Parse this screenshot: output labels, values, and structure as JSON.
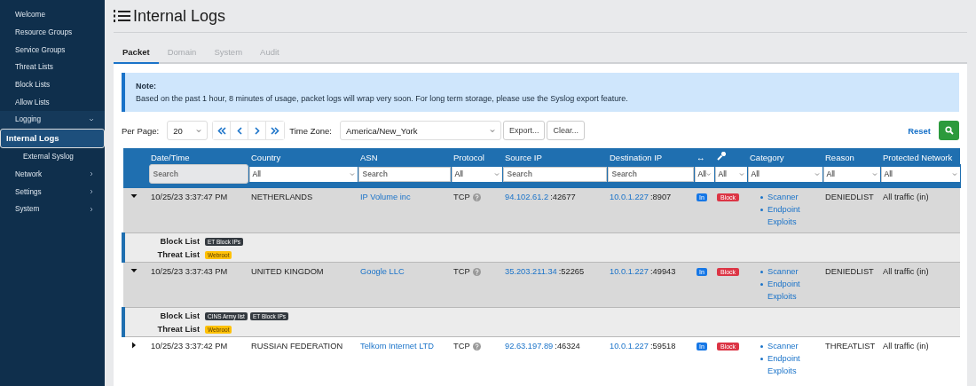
{
  "sidebar": {
    "items": [
      {
        "label": "Welcome",
        "kind": "link",
        "selected": false
      },
      {
        "label": "Resource Groups",
        "kind": "link",
        "selected": false
      },
      {
        "label": "Service Groups",
        "kind": "link",
        "selected": false
      },
      {
        "label": "Threat Lists",
        "kind": "link",
        "selected": false
      },
      {
        "label": "Block Lists",
        "kind": "link",
        "selected": false
      },
      {
        "label": "Allow Lists",
        "kind": "link",
        "selected": false
      },
      {
        "label": "Logging",
        "kind": "group",
        "selected": false,
        "expanded": true,
        "children": [
          {
            "label": "Internal Logs",
            "selected": true
          },
          {
            "label": "External Syslog",
            "selected": false
          }
        ]
      },
      {
        "label": "Network",
        "kind": "group",
        "selected": false,
        "expanded": false
      },
      {
        "label": "Settings",
        "kind": "group",
        "selected": false,
        "expanded": false
      },
      {
        "label": "System",
        "kind": "group",
        "selected": false,
        "expanded": false
      }
    ]
  },
  "page": {
    "title": "Internal Logs"
  },
  "tabs": [
    {
      "label": "Packet",
      "selected": true
    },
    {
      "label": "Domain",
      "selected": false
    },
    {
      "label": "System",
      "selected": false
    },
    {
      "label": "Audit",
      "selected": false
    }
  ],
  "note": {
    "title": "Note:",
    "text": "Based on the past 1 hour, 8 minutes of usage, packet logs will wrap very soon. For long term storage, please use the Syslog export feature."
  },
  "toolbar": {
    "per_page_label": "Per Page:",
    "per_page": "20",
    "time_zone_label": "Time Zone:",
    "time_zone": "America/New_York",
    "buttons": [
      "Export...",
      "Clear..."
    ],
    "reset": "Reset"
  },
  "table": {
    "columns": [
      {
        "kind": "expander"
      },
      {
        "kind": "text",
        "label": "Date/Time",
        "filter": {
          "kind": "search",
          "placeholder": "Search",
          "disabled": true
        }
      },
      {
        "kind": "text",
        "label": "Country",
        "filter": {
          "kind": "select",
          "value": "All"
        }
      },
      {
        "kind": "text",
        "label": "ASN",
        "filter": {
          "kind": "search",
          "placeholder": "Search",
          "disabled": false
        }
      },
      {
        "kind": "text",
        "label": "Protocol",
        "filter": {
          "kind": "select",
          "value": "All"
        }
      },
      {
        "kind": "text",
        "label": "Source IP",
        "filter": {
          "kind": "search",
          "placeholder": "Search",
          "disabled": false
        }
      },
      {
        "kind": "text",
        "label": "Destination IP",
        "filter": {
          "kind": "search",
          "placeholder": "Search",
          "disabled": false
        }
      },
      {
        "kind": "text",
        "label": "↔",
        "filter": {
          "kind": "select",
          "value": "All"
        }
      },
      {
        "kind": "icon",
        "filter": {
          "kind": "select",
          "value": "All"
        }
      },
      {
        "kind": "text",
        "label": "Category",
        "filter": {
          "kind": "select",
          "value": "All"
        }
      },
      {
        "kind": "text",
        "label": "Reason",
        "filter": {
          "kind": "select",
          "value": "All"
        }
      },
      {
        "kind": "text",
        "label": "Protected Network",
        "filter": {
          "kind": "select",
          "value": "All"
        }
      }
    ],
    "rows": [
      {
        "expanded": true,
        "date": "10/25/23 3:37:47 PM",
        "country": "NETHERLANDS",
        "asn": "IP Volume inc",
        "protocol": "TCP",
        "source_ip": "94.102.61.2",
        "source_port": ":42677",
        "dest_ip": "10.0.1.227",
        "dest_port": ":8907",
        "direction": "In",
        "action": "Block",
        "categories": [
          "Scanner",
          "Endpoint Exploits"
        ],
        "reason": "DENIEDLIST",
        "network": "All traffic (in)",
        "details": [
          {
            "label": "Block List",
            "tags": [
              {
                "label": "ET Block IPs",
                "color": "#343a40"
              }
            ]
          },
          {
            "label": "Threat List",
            "tags": [
              {
                "label": "Webroot",
                "color": "#ffc107"
              }
            ]
          }
        ]
      },
      {
        "expanded": true,
        "date": "10/25/23 3:37:43 PM",
        "country": "UNITED KINGDOM",
        "asn": "Google LLC",
        "protocol": "TCP",
        "source_ip": "35.203.211.34",
        "source_port": ":52265",
        "dest_ip": "10.0.1.227",
        "dest_port": ":49943",
        "direction": "In",
        "action": "Block",
        "categories": [
          "Scanner",
          "Endpoint Exploits"
        ],
        "reason": "DENIEDLIST",
        "network": "All traffic (in)",
        "details": [
          {
            "label": "Block List",
            "tags": [
              {
                "label": "CINS Army list",
                "color": "#343a40"
              },
              {
                "label": "ET Block IPs",
                "color": "#343a40"
              }
            ]
          },
          {
            "label": "Threat List",
            "tags": [
              {
                "label": "Webroot",
                "color": "#ffc107"
              }
            ]
          }
        ]
      },
      {
        "expanded": false,
        "date": "10/25/23 3:37:42 PM",
        "country": "RUSSIAN FEDERATION",
        "asn": "Telkom Internet LTD",
        "protocol": "TCP",
        "source_ip": "92.63.197.89",
        "source_port": ":46324",
        "dest_ip": "10.0.1.227",
        "dest_port": ":59518",
        "direction": "In",
        "action": "Block",
        "categories": [
          "Scanner",
          "Endpoint Exploits"
        ],
        "reason": "THREATLIST",
        "network": "All traffic (in)"
      }
    ]
  }
}
